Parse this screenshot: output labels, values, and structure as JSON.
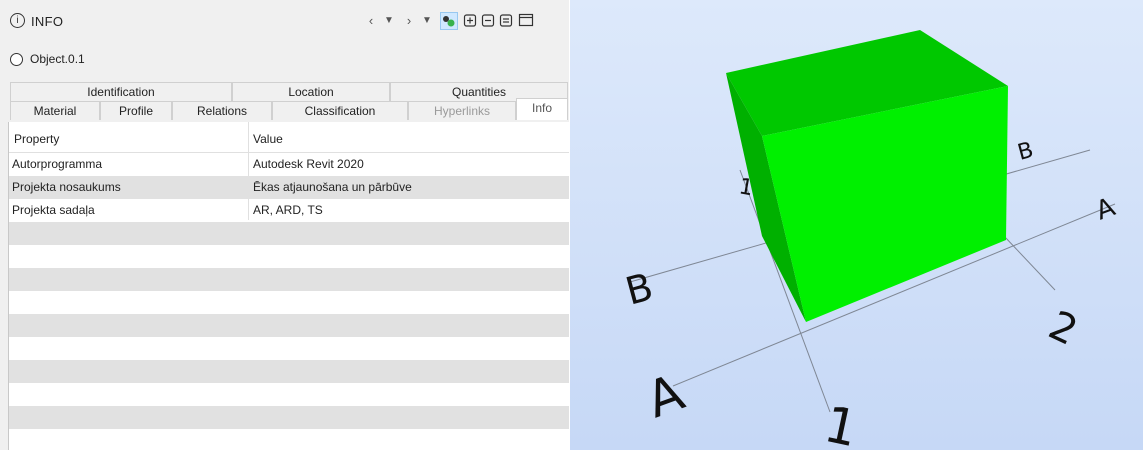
{
  "panel": {
    "title": "INFO",
    "object_name": "Object.0.1"
  },
  "tabs": {
    "row1": [
      "Identification",
      "Location",
      "Quantities"
    ],
    "row2": [
      "Material",
      "Profile",
      "Relations",
      "Classification",
      "Hyperlinks",
      "Info"
    ],
    "active": "Info"
  },
  "table": {
    "headers": [
      "Property",
      "Value"
    ],
    "rows": [
      {
        "property": "Autorprogramma",
        "value": "Autodesk Revit 2020"
      },
      {
        "property": "Projekta nosaukums",
        "value": "Ēkas atjaunošana un pārbūve"
      },
      {
        "property": "Projekta sadaļa",
        "value": "AR, ARD, TS"
      }
    ]
  },
  "viewport": {
    "axis_labels": [
      "A",
      "B",
      "1",
      "2",
      "A",
      "B",
      "1"
    ],
    "cube_color": "#00ff00"
  },
  "toolbar": {
    "prev_icon": "chevron-left-icon",
    "next_icon": "chevron-right-icon"
  }
}
